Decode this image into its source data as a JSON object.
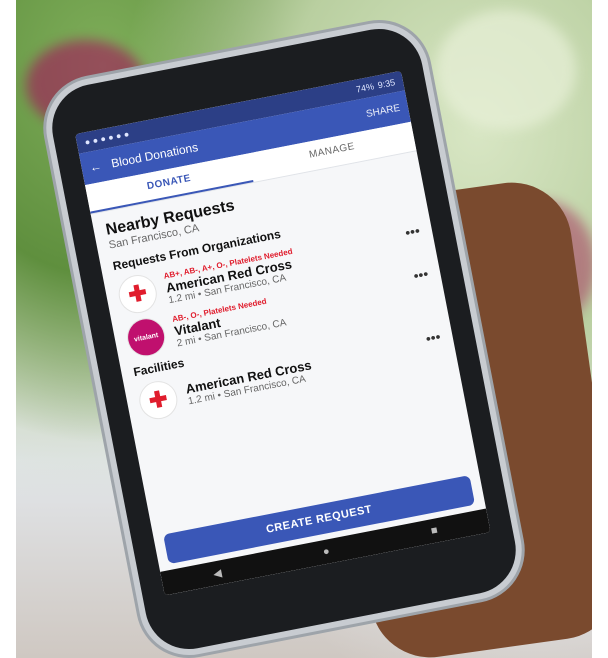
{
  "app": {
    "title": "Blood Donations",
    "share_label": "SHARE",
    "status_time": "9:35",
    "battery": "74%"
  },
  "tabs": [
    {
      "label": "DONATE",
      "active": true
    },
    {
      "label": "MANAGE",
      "active": false
    }
  ],
  "main": {
    "title": "Nearby Requests",
    "location": "San Francisco, CA",
    "section_orgs": "Requests From Organizations",
    "section_facilities": "Facilities"
  },
  "requests": [
    {
      "need": "AB+, AB-, A+, O-, Platelets Needed",
      "name": "American Red Cross",
      "meta": "1.2 mi • San Francisco, CA",
      "logo_icon": "red-cross-icon"
    },
    {
      "need": "AB-, O-, Platelets Needed",
      "name": "Vitalant",
      "meta": "2 mi • San Francisco, CA",
      "logo_icon": "vitalant-logo"
    }
  ],
  "facilities": [
    {
      "name": "American Red Cross",
      "meta": "1.2 mi • San Francisco, CA",
      "logo_icon": "red-cross-icon"
    }
  ],
  "cta": {
    "label": "CREATE REQUEST"
  },
  "colors": {
    "brand_blue": "#3a57b7",
    "need_red": "#e01d2d",
    "vitalant_magenta": "#c0106e"
  }
}
